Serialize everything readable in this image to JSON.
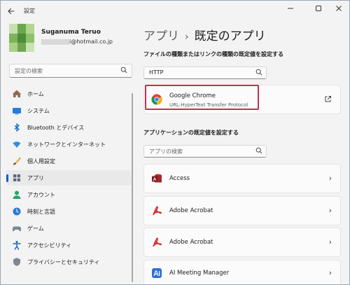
{
  "window": {
    "title": "設定",
    "back_icon": "back-arrow-icon",
    "controls": [
      "minimize-icon",
      "maximize-icon",
      "close-icon"
    ]
  },
  "user": {
    "name": "Suganuma Teruo",
    "email_visible": "i@hotmail.co.jp"
  },
  "sidebar": {
    "search_placeholder": "設定の検索",
    "items": [
      {
        "label": "ホーム",
        "icon": "home-icon",
        "selected": false
      },
      {
        "label": "システム",
        "icon": "system-display-icon",
        "selected": false
      },
      {
        "label": "Bluetooth とデバイス",
        "icon": "bluetooth-icon",
        "selected": false
      },
      {
        "label": "ネットワークとインターネット",
        "icon": "network-wifi-icon",
        "selected": false
      },
      {
        "label": "個人用設定",
        "icon": "personalization-brush-icon",
        "selected": false
      },
      {
        "label": "アプリ",
        "icon": "apps-icon",
        "selected": true
      },
      {
        "label": "アカウント",
        "icon": "account-person-icon",
        "selected": false
      },
      {
        "label": "時刻と言語",
        "icon": "time-language-icon",
        "selected": false
      },
      {
        "label": "ゲーム",
        "icon": "gaming-controller-icon",
        "selected": false
      },
      {
        "label": "アクセシビリティ",
        "icon": "accessibility-icon",
        "selected": false
      },
      {
        "label": "プライバシーとセキュリティ",
        "icon": "privacy-shield-icon",
        "selected": false
      }
    ]
  },
  "main": {
    "breadcrumb": {
      "parent": "アプリ",
      "separator": "›",
      "current": "既定のアプリ"
    },
    "file_type_section": {
      "label": "ファイルの種類またはリンクの種類の既定値を設定する",
      "search_value": "HTTP",
      "result": {
        "name": "Google Chrome",
        "subtitle": "URL:HyperText Transfer Protocol",
        "icon": "google-chrome-icon",
        "action_icon": "open-external-icon"
      }
    },
    "apps_section": {
      "label": "アプリケーションの既定値を設定する",
      "search_placeholder": "アプリの検索",
      "apps": [
        {
          "name": "Access",
          "icon": "access-icon"
        },
        {
          "name": "Adobe Acrobat",
          "icon": "adobe-acrobat-icon"
        },
        {
          "name": "Adobe Acrobat",
          "icon": "adobe-acrobat-icon"
        },
        {
          "name": "AI Meeting Manager",
          "icon": "ai-meeting-manager-icon"
        }
      ]
    }
  },
  "colors": {
    "accent": "#005fb8",
    "highlight_border": "#c4304e",
    "window_bg": "#f3f3f3",
    "card_bg": "#fbfbfb"
  }
}
